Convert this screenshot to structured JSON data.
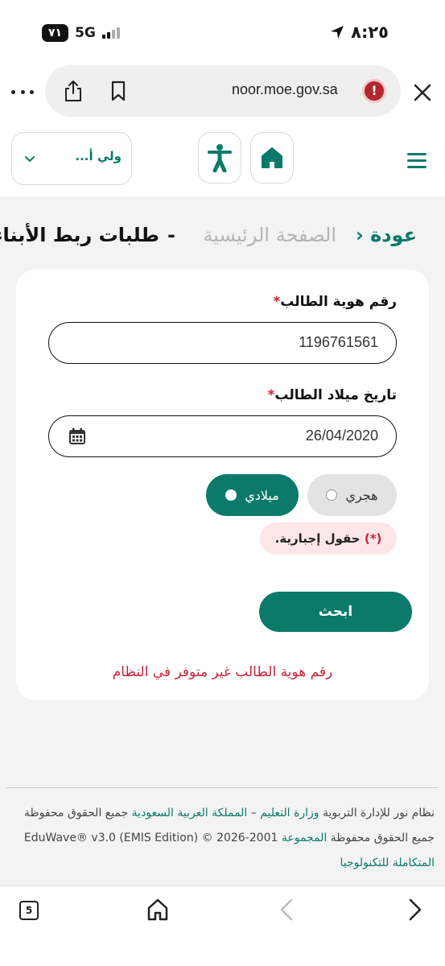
{
  "status_bar": {
    "time": "٨:٢٥",
    "battery": "٧١",
    "network": "5G"
  },
  "browser": {
    "url": "noor.moe.gov.sa",
    "icons": [
      "more-icon",
      "share-icon",
      "bookmark-icon",
      "alert-icon",
      "close-icon"
    ]
  },
  "header": {
    "role_label": "ولي أ...",
    "icons": [
      "chevron-down-icon",
      "accessibility-icon",
      "home-icon",
      "menu-icon"
    ],
    "accent_color": "#0b7a6a"
  },
  "breadcrumb": {
    "back": "عودة",
    "home": "الصفحة الرئيسية",
    "separator": "-",
    "title": "طلبات ربط الأبناء"
  },
  "form": {
    "id_label": "رقم هوية الطالب",
    "id_value": "1196761561",
    "dob_label": "تاريخ ميلاد الطالب",
    "dob_value": "26/04/2020",
    "required_star": "*",
    "calendar_options": [
      {
        "label": "هجري",
        "selected": false
      },
      {
        "label": "ميلادي",
        "selected": true
      }
    ],
    "required_note_star": "(*)",
    "required_note_text": "حقول إجبارية.",
    "search_label": "ابحث",
    "error_message": "رقم هوية الطالب غير متوفر في النظام",
    "error_color": "#c8243a"
  },
  "footer": {
    "line1_part1": "نظام نور للإدارة التربوية ",
    "line1_link1": "وزارة التعليم",
    "line1_part2": " – ",
    "line1_link2": "المملكة العربية السعودية",
    "line1_part3": " جميع الحقوق محفوظة",
    "line2_part1": "جميع الحقوق محفوظة ",
    "line2_link": "المجموعة",
    "line2_part2": " 2001-2026 © EduWave® v3.0 (EMIS Edition)",
    "line3_link": "المتكاملة للتكنولوجيا"
  },
  "toolbar": {
    "tabs_count": "5",
    "icons": [
      "tabs-icon",
      "home-icon",
      "back-arrow-icon",
      "forward-arrow-icon"
    ]
  }
}
